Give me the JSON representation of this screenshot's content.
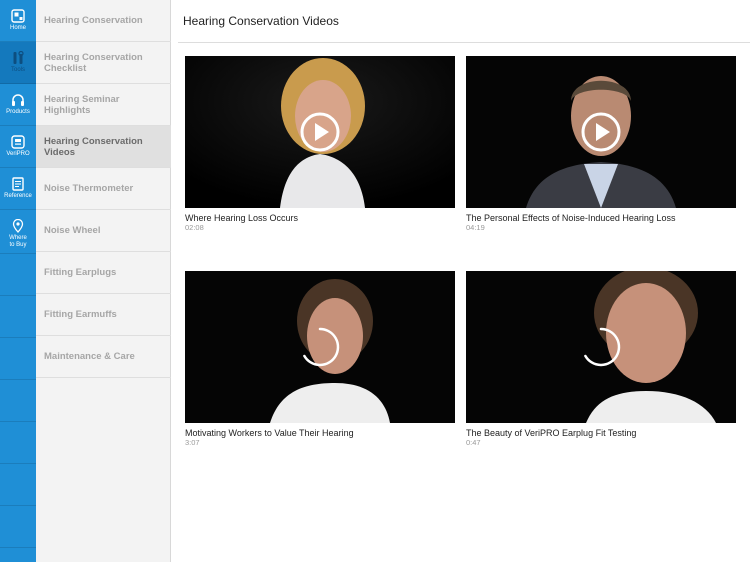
{
  "rail": {
    "items": [
      {
        "label": "Home",
        "icon": "home-icon"
      },
      {
        "label": "Tools",
        "icon": "tools-icon"
      },
      {
        "label": "Products",
        "icon": "headphones-icon"
      },
      {
        "label": "VeriPRO",
        "icon": "veripro-icon"
      },
      {
        "label": "Reference",
        "icon": "document-icon"
      },
      {
        "label": "Where\nto Buy",
        "icon": "location-pin-icon"
      }
    ],
    "active_index": 1,
    "colors": {
      "background": "#1f8fd6",
      "active": "#1479bd"
    }
  },
  "submenu": {
    "items": [
      {
        "label": "Hearing Conservation"
      },
      {
        "label": "Hearing Conservation Checklist"
      },
      {
        "label": "Hearing Seminar Highlights"
      },
      {
        "label": "Hearing Conservation Videos"
      },
      {
        "label": "Noise Thermometer"
      },
      {
        "label": "Noise Wheel"
      },
      {
        "label": "Fitting Earplugs"
      },
      {
        "label": "Fitting Earmuffs"
      },
      {
        "label": "Maintenance & Care"
      }
    ],
    "active_index": 3
  },
  "main": {
    "title": "Hearing Conservation Videos",
    "videos": [
      {
        "title": "Where Hearing Loss Occurs",
        "duration": "02:08",
        "state": "play"
      },
      {
        "title": "The Personal Effects of Noise-Induced Hearing Loss",
        "duration": "04:19",
        "state": "play"
      },
      {
        "title": "Motivating Workers to Value Their Hearing",
        "duration": "3:07",
        "state": "loading"
      },
      {
        "title": "The Beauty of VeriPRO Earplug Fit Testing",
        "duration": "0:47",
        "state": "loading"
      }
    ]
  }
}
